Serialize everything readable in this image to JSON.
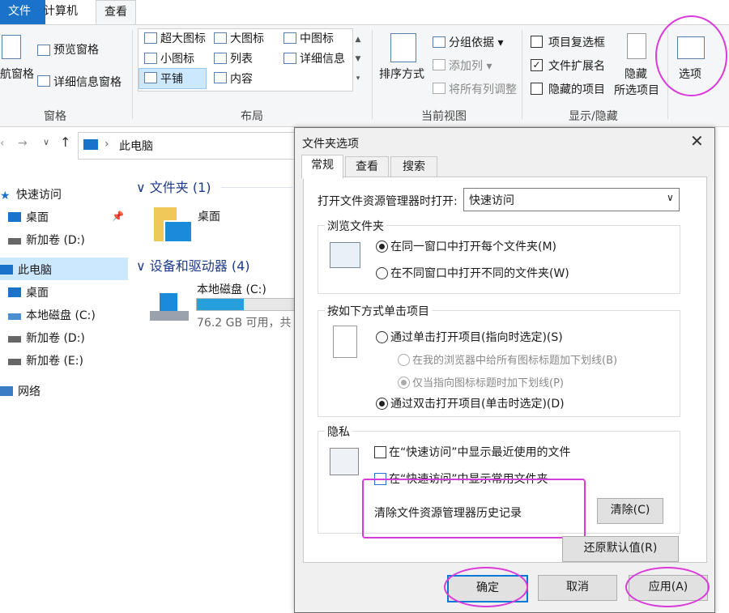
{
  "tabs": {
    "file": "文件",
    "computer": "计算机",
    "view": "查看"
  },
  "ribbon": {
    "pane": {
      "nav_pane": "航窗格",
      "preview": "预览窗格",
      "details": "详细信息窗格",
      "group": "窗格"
    },
    "layout": {
      "items": [
        "超大图标",
        "大图标",
        "中图标",
        "小图标",
        "列表",
        "详细信息",
        "平铺",
        "内容"
      ],
      "group": "布局"
    },
    "current_view": {
      "sort": "排序方式",
      "group_by": "分组依据",
      "add_column": "添加列",
      "fit_columns": "将所有列调整",
      "group": "当前视图"
    },
    "show_hide": {
      "item_checkboxes": "项目复选框",
      "file_ext": "文件扩展名",
      "hidden_items": "隐藏的项目",
      "hide": "隐藏",
      "selected_items": "所选项目",
      "group": "显示/隐藏"
    },
    "options": "选项"
  },
  "address": {
    "path": "此电脑",
    "sep": "›"
  },
  "nav": {
    "quick_access": "快速访问",
    "desktop": "桌面",
    "drive_d": "新加卷 (D:)",
    "this_pc": "此电脑",
    "desktop2": "桌面",
    "local_c": "本地磁盘 (C:)",
    "drive_d2": "新加卷 (D:)",
    "drive_e": "新加卷 (E:)",
    "network": "网络"
  },
  "content": {
    "folders_header": "文件夹 (1)",
    "folder_desktop": "桌面",
    "devices_header": "设备和驱动器 (4)",
    "local_disk": "本地磁盘 (C:)",
    "free_space": "76.2 GB 可用，共",
    "disk_used_fraction": 0.48
  },
  "dialog": {
    "title": "文件夹选项",
    "tabs": [
      "常规",
      "查看",
      "搜索"
    ],
    "open_label": "打开文件资源管理器时打开:",
    "open_value": "快速访问",
    "browse": {
      "title": "浏览文件夹",
      "opt1": "在同一窗口中打开每个文件夹(M)",
      "opt2": "在不同窗口中打开不同的文件夹(W)"
    },
    "click": {
      "title": "按如下方式单击项目",
      "single": "通过单击打开项目(指向时选定)(S)",
      "sub1": "在我的浏览器中给所有图标标题加下划线(B)",
      "sub2": "仅当指向图标标题时加下划线(P)",
      "double": "通过双击打开项目(单击时选定)(D)"
    },
    "privacy": {
      "title": "隐私",
      "recent": "在“快速访问”中显示最近使用的文件",
      "frequent": "在“快速访问”中显示常用文件夹",
      "clear_label": "清除文件资源管理器历史记录",
      "clear_btn": "清除(C)"
    },
    "restore": "还原默认值(R)",
    "ok": "确定",
    "cancel": "取消",
    "apply": "应用(A)"
  },
  "colors": {
    "accent": "#1a73c9",
    "highlight": "#d93ad9",
    "selection": "#cce8ff"
  }
}
